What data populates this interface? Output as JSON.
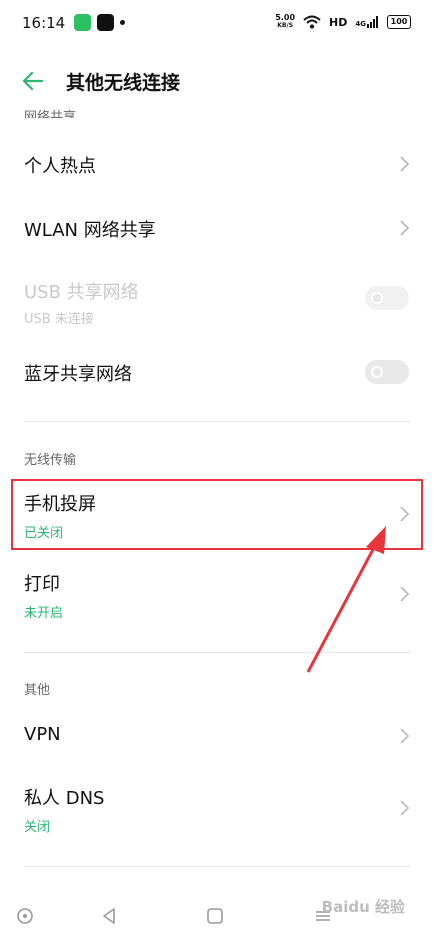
{
  "status_bar": {
    "time": "16:14",
    "net_speed_value": "5.00",
    "net_speed_unit": "KB/S",
    "hd": "HD",
    "signal": "4G",
    "battery": "100"
  },
  "header": {
    "title": "其他无线连接"
  },
  "section_cutoff": "网络共享",
  "rows": {
    "hotspot": {
      "label": "个人热点"
    },
    "wlan_share": {
      "label": "WLAN 网络共享"
    },
    "usb_share": {
      "label": "USB 共享网络",
      "sub": "USB 未连接"
    },
    "bt_share": {
      "label": "蓝牙共享网络"
    }
  },
  "section_wireless": "无线传输",
  "wireless": {
    "cast": {
      "label": "手机投屏",
      "status": "已关闭"
    },
    "print": {
      "label": "打印",
      "status": "未开启"
    }
  },
  "section_other": "其他",
  "other": {
    "vpn": {
      "label": "VPN"
    },
    "dns": {
      "label": "私人 DNS",
      "status": "关闭"
    }
  },
  "watermark": "Baidu 经验",
  "colors": {
    "accent_green": "#2bb773",
    "highlight_red": "#e8353d"
  }
}
